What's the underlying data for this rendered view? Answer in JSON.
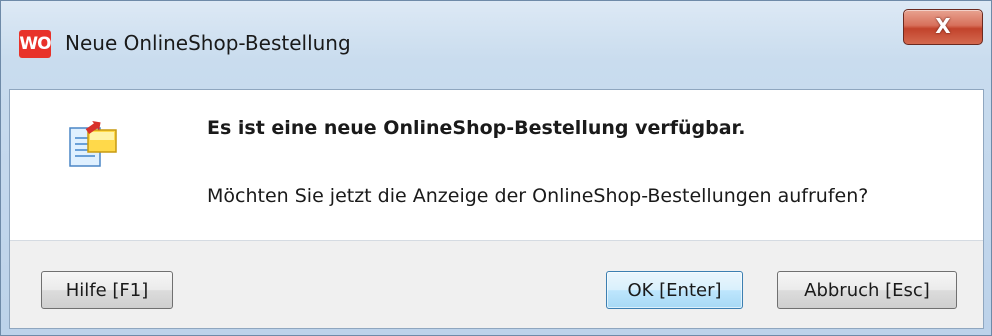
{
  "window": {
    "title": "Neue OnlineShop-Bestellung",
    "app_icon_text": "WO",
    "close_label": "X",
    "accent_color": "#e8322a"
  },
  "message": {
    "icon": "new-order-document-icon",
    "headline": "Es ist eine neue OnlineShop-Bestellung verfügbar.",
    "question": "Möchten Sie jetzt die Anzeige der OnlineShop-Bestellungen aufrufen?"
  },
  "buttons": {
    "help_label": "Hilfe [F1]",
    "ok_label": "OK [Enter]",
    "cancel_label": "Abbruch [Esc]"
  }
}
